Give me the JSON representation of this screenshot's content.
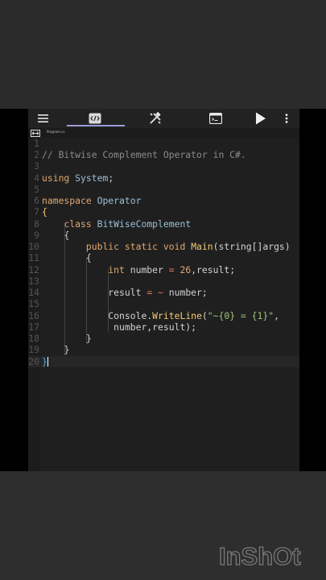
{
  "app": {
    "mini_label": "Program.cs"
  },
  "toolbar": {
    "icons": [
      "menu-icon",
      "code-tab-icon",
      "tools-icon",
      "console-icon",
      "run-icon",
      "more-icon"
    ]
  },
  "editor": {
    "lines": [
      {
        "n": "1"
      },
      {
        "n": "2"
      },
      {
        "n": "3"
      },
      {
        "n": "4"
      },
      {
        "n": "5"
      },
      {
        "n": "6"
      },
      {
        "n": "7"
      },
      {
        "n": "8"
      },
      {
        "n": "9"
      },
      {
        "n": "10"
      },
      {
        "n": "11"
      },
      {
        "n": "12"
      },
      {
        "n": "13"
      },
      {
        "n": "14"
      },
      {
        "n": "15"
      },
      {
        "n": "16"
      },
      {
        "n": "17"
      },
      {
        "n": "18"
      },
      {
        "n": "19"
      },
      {
        "n": "20"
      }
    ],
    "tokens": {
      "l2_comment": "// Bitwise Complement Operator in C#.",
      "l4_using": "using",
      "l4_system": "System",
      "l4_semi": ";",
      "l6_namespace": "namespace",
      "l6_operator": "Operator",
      "l7_brace": "{",
      "l8_class": "class",
      "l8_name": "BitWiseComplement",
      "l9_brace": "{",
      "l10_public": "public",
      "l10_static": "static",
      "l10_void": "void",
      "l10_main": "Main",
      "l10_args": "(string[]args)",
      "l11_brace": "{",
      "l12_int": "int",
      "l12_number": "number",
      "l12_eq": "=",
      "l12_val": "26",
      "l12_rest": ",result;",
      "l14_result": "result",
      "l14_eq": "=",
      "l14_tilde": "~",
      "l14_rest": "number;",
      "l16_console": "Console.",
      "l16_writeline": "WriteLine",
      "l16_paren": "(",
      "l16_str": "\"~{0} = {1}\"",
      "l16_comma": ",",
      "l17_args": "number,result);",
      "l18_brace": "}",
      "l19_brace": "}",
      "l20_brace": "}"
    }
  },
  "watermark": {
    "text": "InShOt"
  }
}
